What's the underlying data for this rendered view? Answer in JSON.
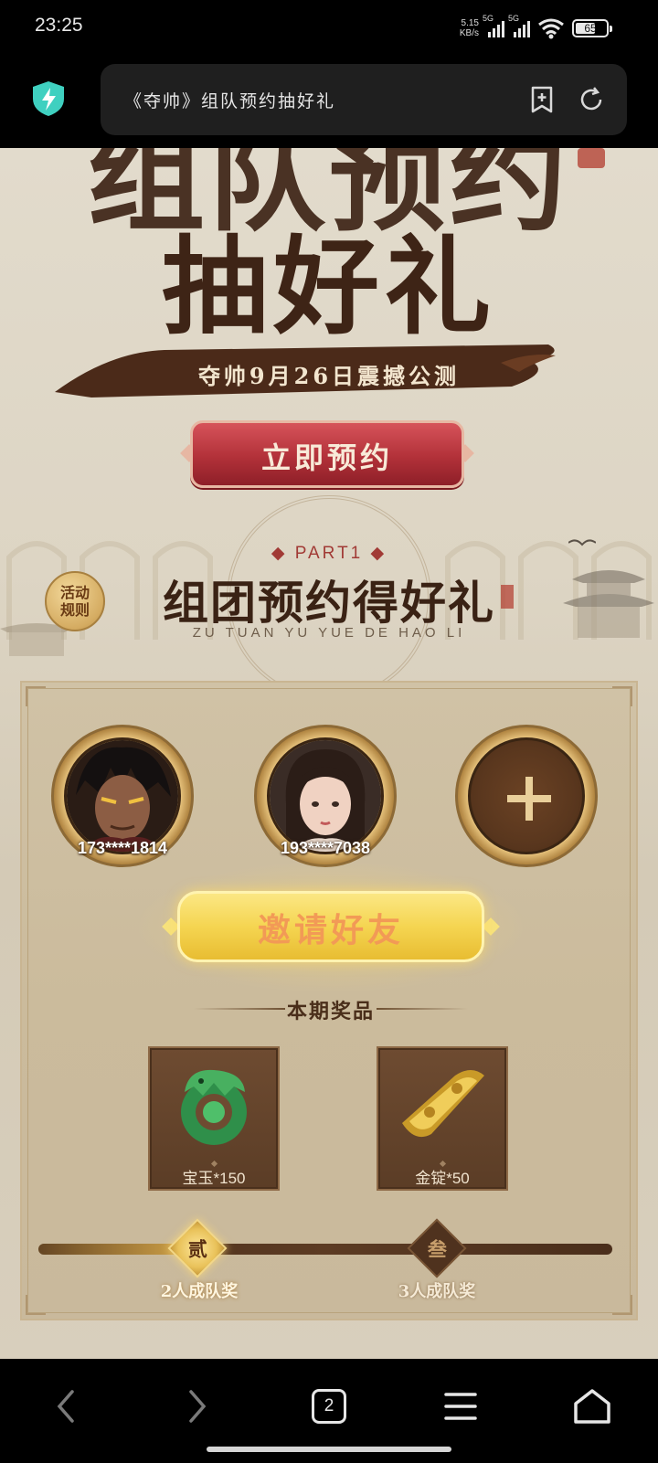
{
  "status_bar": {
    "time": "23:25",
    "net_speed_value": "5.15",
    "net_speed_unit": "KB/s",
    "sim1": "5G",
    "sim2": "5G",
    "battery": "65",
    "battery_level": 0.65
  },
  "browser": {
    "url_title": "《夺帅》组队预约抽好礼"
  },
  "hero": {
    "title_line1": "组队预约",
    "title_line2": "抽好礼",
    "subtitle": "夺帅9月26日震撼公测",
    "reserve_button": "立即预约"
  },
  "section": {
    "part_label": "◆ PART1 ◆",
    "title": "组团预约得好礼",
    "pinyin": "ZU TUAN YU YUE DE HAO LI",
    "rules_button": "活动规则"
  },
  "team": {
    "members": [
      {
        "phone": "173****1814",
        "avatar": "male-warrior-avatar"
      },
      {
        "phone": "193****7038",
        "avatar": "female-avatar"
      }
    ],
    "add_icon": "plus-icon",
    "invite_button": "邀请好友"
  },
  "prizes": {
    "heading": "本期奖品",
    "items": [
      {
        "name": "宝玉*150",
        "icon": "jade-dragon-icon"
      },
      {
        "name": "金锭*50",
        "icon": "gold-ingot-icon"
      }
    ]
  },
  "progress": {
    "fill_fraction": 0.28,
    "milestones": [
      {
        "mark": "贰",
        "label": "2人成队奖",
        "state": "achieved"
      },
      {
        "mark": "叁",
        "label": "3人成队奖",
        "state": "pending"
      }
    ]
  },
  "nav": {
    "tab_count": "2",
    "icons": [
      "back-icon",
      "forward-icon",
      "tabs-icon",
      "menu-icon",
      "home-icon"
    ]
  },
  "colors": {
    "accent_red": "#b23139",
    "invite_gold": "#f5d551",
    "title_brown": "#3e2416",
    "panel_bg": "#cbbb9c"
  }
}
